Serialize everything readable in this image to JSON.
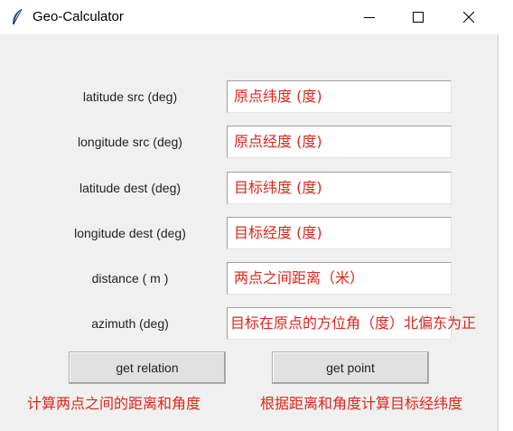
{
  "window": {
    "title": "Geo-Calculator",
    "app_icon": "feather-icon",
    "controls": {
      "minimize": "minimize-icon",
      "maximize": "maximize-icon",
      "close": "close-icon"
    }
  },
  "form": {
    "fields": [
      {
        "label": "latitude  src (deg)",
        "value": "原点纬度 (度)"
      },
      {
        "label": "longitude src (deg)",
        "value": "原点经度 (度)"
      },
      {
        "label": "latitude  dest (deg)",
        "value": "目标纬度 (度)"
      },
      {
        "label": "longitude dest (deg)",
        "value": "目标经度 (度)"
      },
      {
        "label": "distance ( m )",
        "value": "两点之间距离（米）"
      },
      {
        "label": "azimuth (deg)",
        "value": "目标在原点的方位角（度）北偏东为正"
      }
    ]
  },
  "buttons": {
    "relation": {
      "label": "get relation",
      "note": "计算两点之间的距离和角度"
    },
    "point": {
      "label": "get point",
      "note": "根据距离和角度计算目标经纬度"
    }
  },
  "colors": {
    "accent_text": "#d9281c",
    "window_bg": "#f0f0f0",
    "button_bg": "#e1e1e1"
  }
}
